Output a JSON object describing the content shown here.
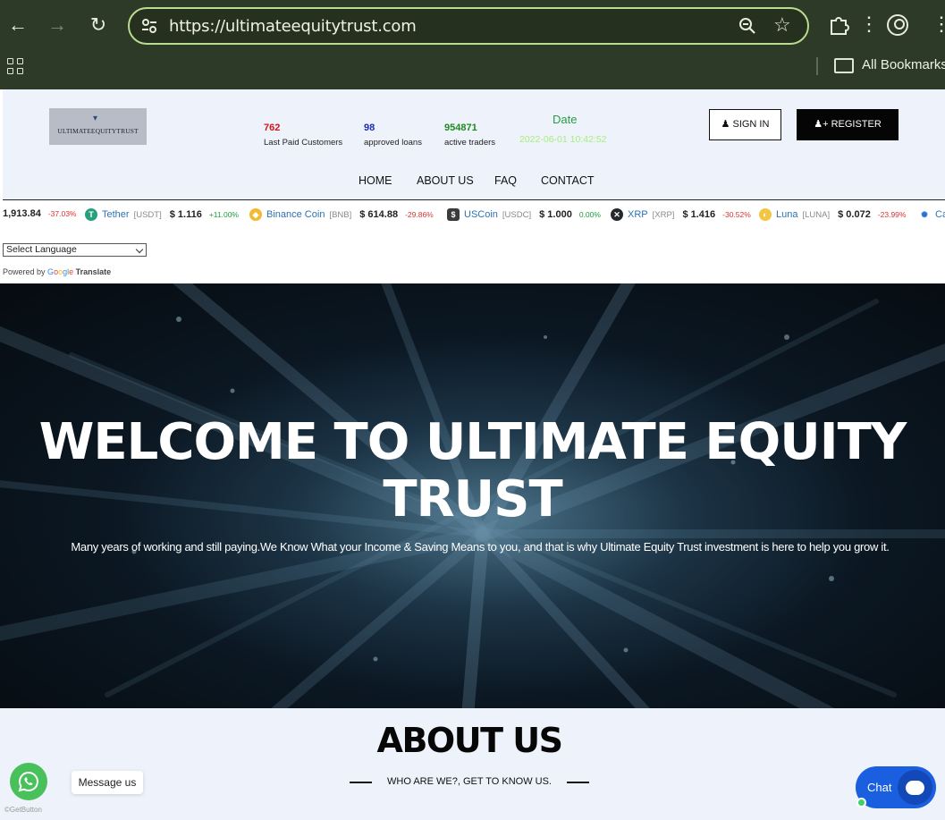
{
  "browser": {
    "url": "https://ultimateequitytrust.com",
    "bookmarks_label": "All Bookmarks"
  },
  "header": {
    "logo_text": "ULTIMATEEQUITYTRUST",
    "stats": [
      {
        "value": "762",
        "label": "Last Paid Customers",
        "color": "#d4141c"
      },
      {
        "value": "98",
        "label": "approved loans",
        "color": "#1a2bb5"
      },
      {
        "value": "954871",
        "label": "active traders",
        "color": "#1f8a1f"
      }
    ],
    "date_label": "Date",
    "date_value": "2022-06-01 10:42:52",
    "signin_label": "SIGN IN",
    "register_label": "REGISTER",
    "nav": [
      "HOME",
      "ABOUT US",
      "FAQ",
      "CONTACT"
    ]
  },
  "ticker": [
    {
      "name": "",
      "symbol": "",
      "price": "1,913.84",
      "change": "-37.03%",
      "dir": "neg",
      "icon": "none"
    },
    {
      "name": "Tether",
      "symbol": "[USDT]",
      "price": "$ 1.116",
      "change": "+11.00%",
      "dir": "pos",
      "icon": "tether-icon",
      "icon_color": "#26a17b",
      "icon_glyph": "T"
    },
    {
      "name": "Binance Coin",
      "symbol": "[BNB]",
      "price": "$ 614.88",
      "change": "-29.86%",
      "dir": "neg",
      "icon": "binance-icon",
      "icon_color": "#f3ba2f",
      "icon_glyph": "◆"
    },
    {
      "name": "USCoin",
      "symbol": "[USDC]",
      "price": "$ 1.000",
      "change": "0.00%",
      "dir": "pos",
      "icon": "usdc-icon",
      "icon_color": "#3b3b3b",
      "icon_glyph": "$"
    },
    {
      "name": "XRP",
      "symbol": "[XRP]",
      "price": "$ 1.416",
      "change": "-30.52%",
      "dir": "neg",
      "icon": "xrp-icon",
      "icon_color": "#23292f",
      "icon_glyph": "✕"
    },
    {
      "name": "Luna",
      "symbol": "[LUNA]",
      "price": "$ 0.072",
      "change": "-23.99%",
      "dir": "neg",
      "icon": "luna-icon",
      "icon_color": "#f4c542",
      "icon_glyph": "◐"
    },
    {
      "name": "Ca",
      "symbol": "",
      "price": "",
      "change": "",
      "dir": "pos",
      "icon": "cardano-icon",
      "icon_color": "#2a71d0",
      "icon_glyph": "✺"
    }
  ],
  "translate": {
    "select_value": "Select Language",
    "powered_prefix": "Powered by",
    "google": "Google",
    "translate": "Translate"
  },
  "hero": {
    "title": "WELCOME TO ULTIMATE EQUITY TRUST",
    "subtitle": "Many years of working and still paying.We Know What your Income & Saving Means to you, and that is why Ultimate Equity Trust investment is here to help you grow it."
  },
  "about": {
    "title": "ABOUT US",
    "subtitle": "WHO ARE WE?, GET TO KNOW US."
  },
  "widgets": {
    "whatsapp_message": "Message us",
    "getbutton": "GetButton",
    "chat_label": "Chat"
  }
}
